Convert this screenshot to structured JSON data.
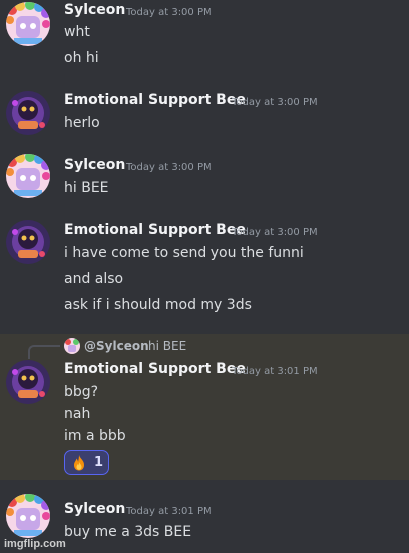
{
  "messages": [
    {
      "author": "Sylceon",
      "timestamp": "Today at 3:00 PM",
      "lines": [
        "wht",
        "oh hi"
      ]
    },
    {
      "author": "Emotional Support Bee",
      "timestamp": "Today at 3:00 PM",
      "lines": [
        "herlo"
      ]
    },
    {
      "author": "Sylceon",
      "timestamp": "Today at 3:00 PM",
      "lines": [
        "hi BEE"
      ]
    },
    {
      "author": "Emotional Support Bee",
      "timestamp": "Today at 3:00 PM",
      "lines": [
        "i have come to send you the funni",
        "and also",
        "ask if i should mod my 3ds"
      ]
    },
    {
      "reply": {
        "mention": "@Sylceon",
        "text": "hi BEE"
      },
      "author": "Emotional Support Bee",
      "timestamp": "Today at 3:01 PM",
      "lines": [
        "bbg?",
        "nah",
        "im a bbb"
      ],
      "reaction": {
        "emoji": "fire-emoji",
        "count": "1"
      }
    },
    {
      "author": "Sylceon",
      "timestamp": "Today at 3:01 PM",
      "lines": [
        "buy me a 3ds BEE"
      ]
    }
  ],
  "watermark": "imgflip.com",
  "colors": {
    "background": "#313338",
    "highlight": "#3c3b36",
    "reaction_bg": "#3b3f6e",
    "reaction_border": "#5865f2"
  }
}
